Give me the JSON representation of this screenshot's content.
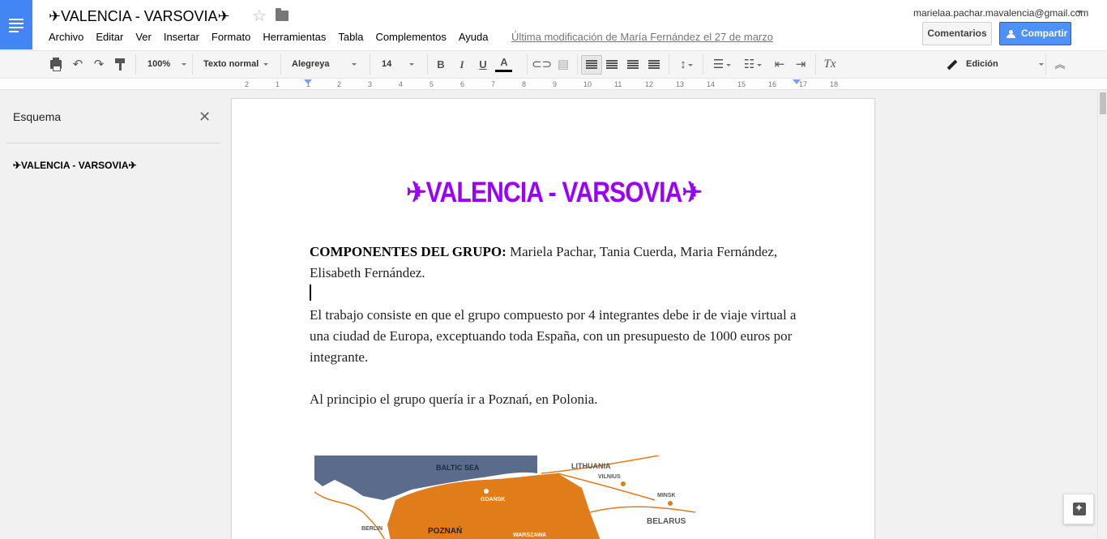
{
  "header": {
    "title": "✈VALENCIA - VARSOVIA✈",
    "menu": [
      "Archivo",
      "Editar",
      "Ver",
      "Insertar",
      "Formato",
      "Herramientas",
      "Tabla",
      "Complementos",
      "Ayuda"
    ],
    "last_edit": "Última modificación de María Fernández el 27 de marzo",
    "account": "marielaa.pachar.mavalencia@gmail.com",
    "comments_label": "Comentarios",
    "share_label": "Compartir"
  },
  "toolbar": {
    "zoom": "100%",
    "style": "Texto normal",
    "font": "Alegreya",
    "size": "14",
    "bold": "B",
    "italic": "I",
    "underline": "U",
    "font_color": "A",
    "mode": "Edición"
  },
  "ruler": {
    "ticks": [
      "2",
      "1",
      "1",
      "2",
      "3",
      "4",
      "5",
      "6",
      "7",
      "8",
      "9",
      "10",
      "11",
      "12",
      "13",
      "14",
      "15",
      "16",
      "17",
      "18"
    ]
  },
  "outline": {
    "title": "Esquema",
    "items": [
      "✈VALENCIA - VARSOVIA✈"
    ]
  },
  "document": {
    "heading": "✈VALENCIA - VARSOVIA✈",
    "components_label": "COMPONENTES DEL GRUPO:",
    "components_text": " Mariela Pachar, Tania Cuerda, Maria Fernández, Elisabeth Fernández.",
    "paragraph_1": "El trabajo consiste en que el grupo compuesto por 4 integrantes debe ir de viaje virtual a una ciudad de Europa, exceptuando toda España, con un presupuesto de 1000 euros por integrante.",
    "paragraph_2": "Al principio el grupo quería ir a Poznań, en Polonia.",
    "map_labels": {
      "sea": "BALTIC SEA",
      "lithuania": "LITHUANIA",
      "vilnius": "VILNIUS",
      "gdansk": "GDAŃSK",
      "minsk": "MINSK",
      "belarus": "BELARUS",
      "berlin": "BERLIN",
      "poznan": "POZNAŃ",
      "warszawa": "WARSZAWA"
    }
  },
  "colors": {
    "heading": "#9900ff",
    "accent": "#4285f4",
    "share_button": "#4d90fe",
    "poland": "#e07c1a",
    "sea": "#5a6b8c"
  }
}
